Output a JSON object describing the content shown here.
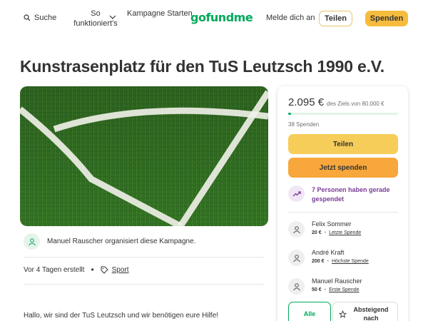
{
  "header": {
    "search_label": "Suche",
    "how_label": "So funktioniert's",
    "start_label": "Kampagne Starten",
    "logo_text": "gofundme",
    "login_label": "Melde dich an",
    "share_label": "Teilen",
    "donate_label": "Spenden"
  },
  "campaign": {
    "title": "Kunstrasenplatz für den TuS Leutzsch 1990 e.V.",
    "organizer_text": "Manuel Rauscher organisiert diese Kampagne.",
    "created": "Vor 4 Tagen erstellt",
    "category": "Sport",
    "intro": "Hallo, wir sind der TuS Leutzsch und wir benötigen eure Hilfe!"
  },
  "sidebar": {
    "raised": "2.095 €",
    "goal_text": "des Ziels von 80.000 €",
    "progress_fraction": 0.026,
    "donor_count": "38 Spenden",
    "share_label": "Teilen",
    "donate_label": "Jetzt spenden",
    "trend_text": "7 Personen haben gerade gespendet",
    "donors": [
      {
        "name": "Felix Sommer",
        "amount": "20 €",
        "tag": "Letzte Spende"
      },
      {
        "name": "André Kraft",
        "amount": "200 €",
        "tag": "Höchste Spende"
      },
      {
        "name": "Manuel Rauscher",
        "amount": "50 €",
        "tag": "Erste Spende"
      }
    ],
    "tab_all": "Alle",
    "tab_top": "Absteigend nach"
  },
  "colors": {
    "brand_green": "#02a95c",
    "donate_orange": "#f7a73b",
    "share_yellow": "#f7cd5a",
    "trend_purple": "#7a3c96"
  }
}
